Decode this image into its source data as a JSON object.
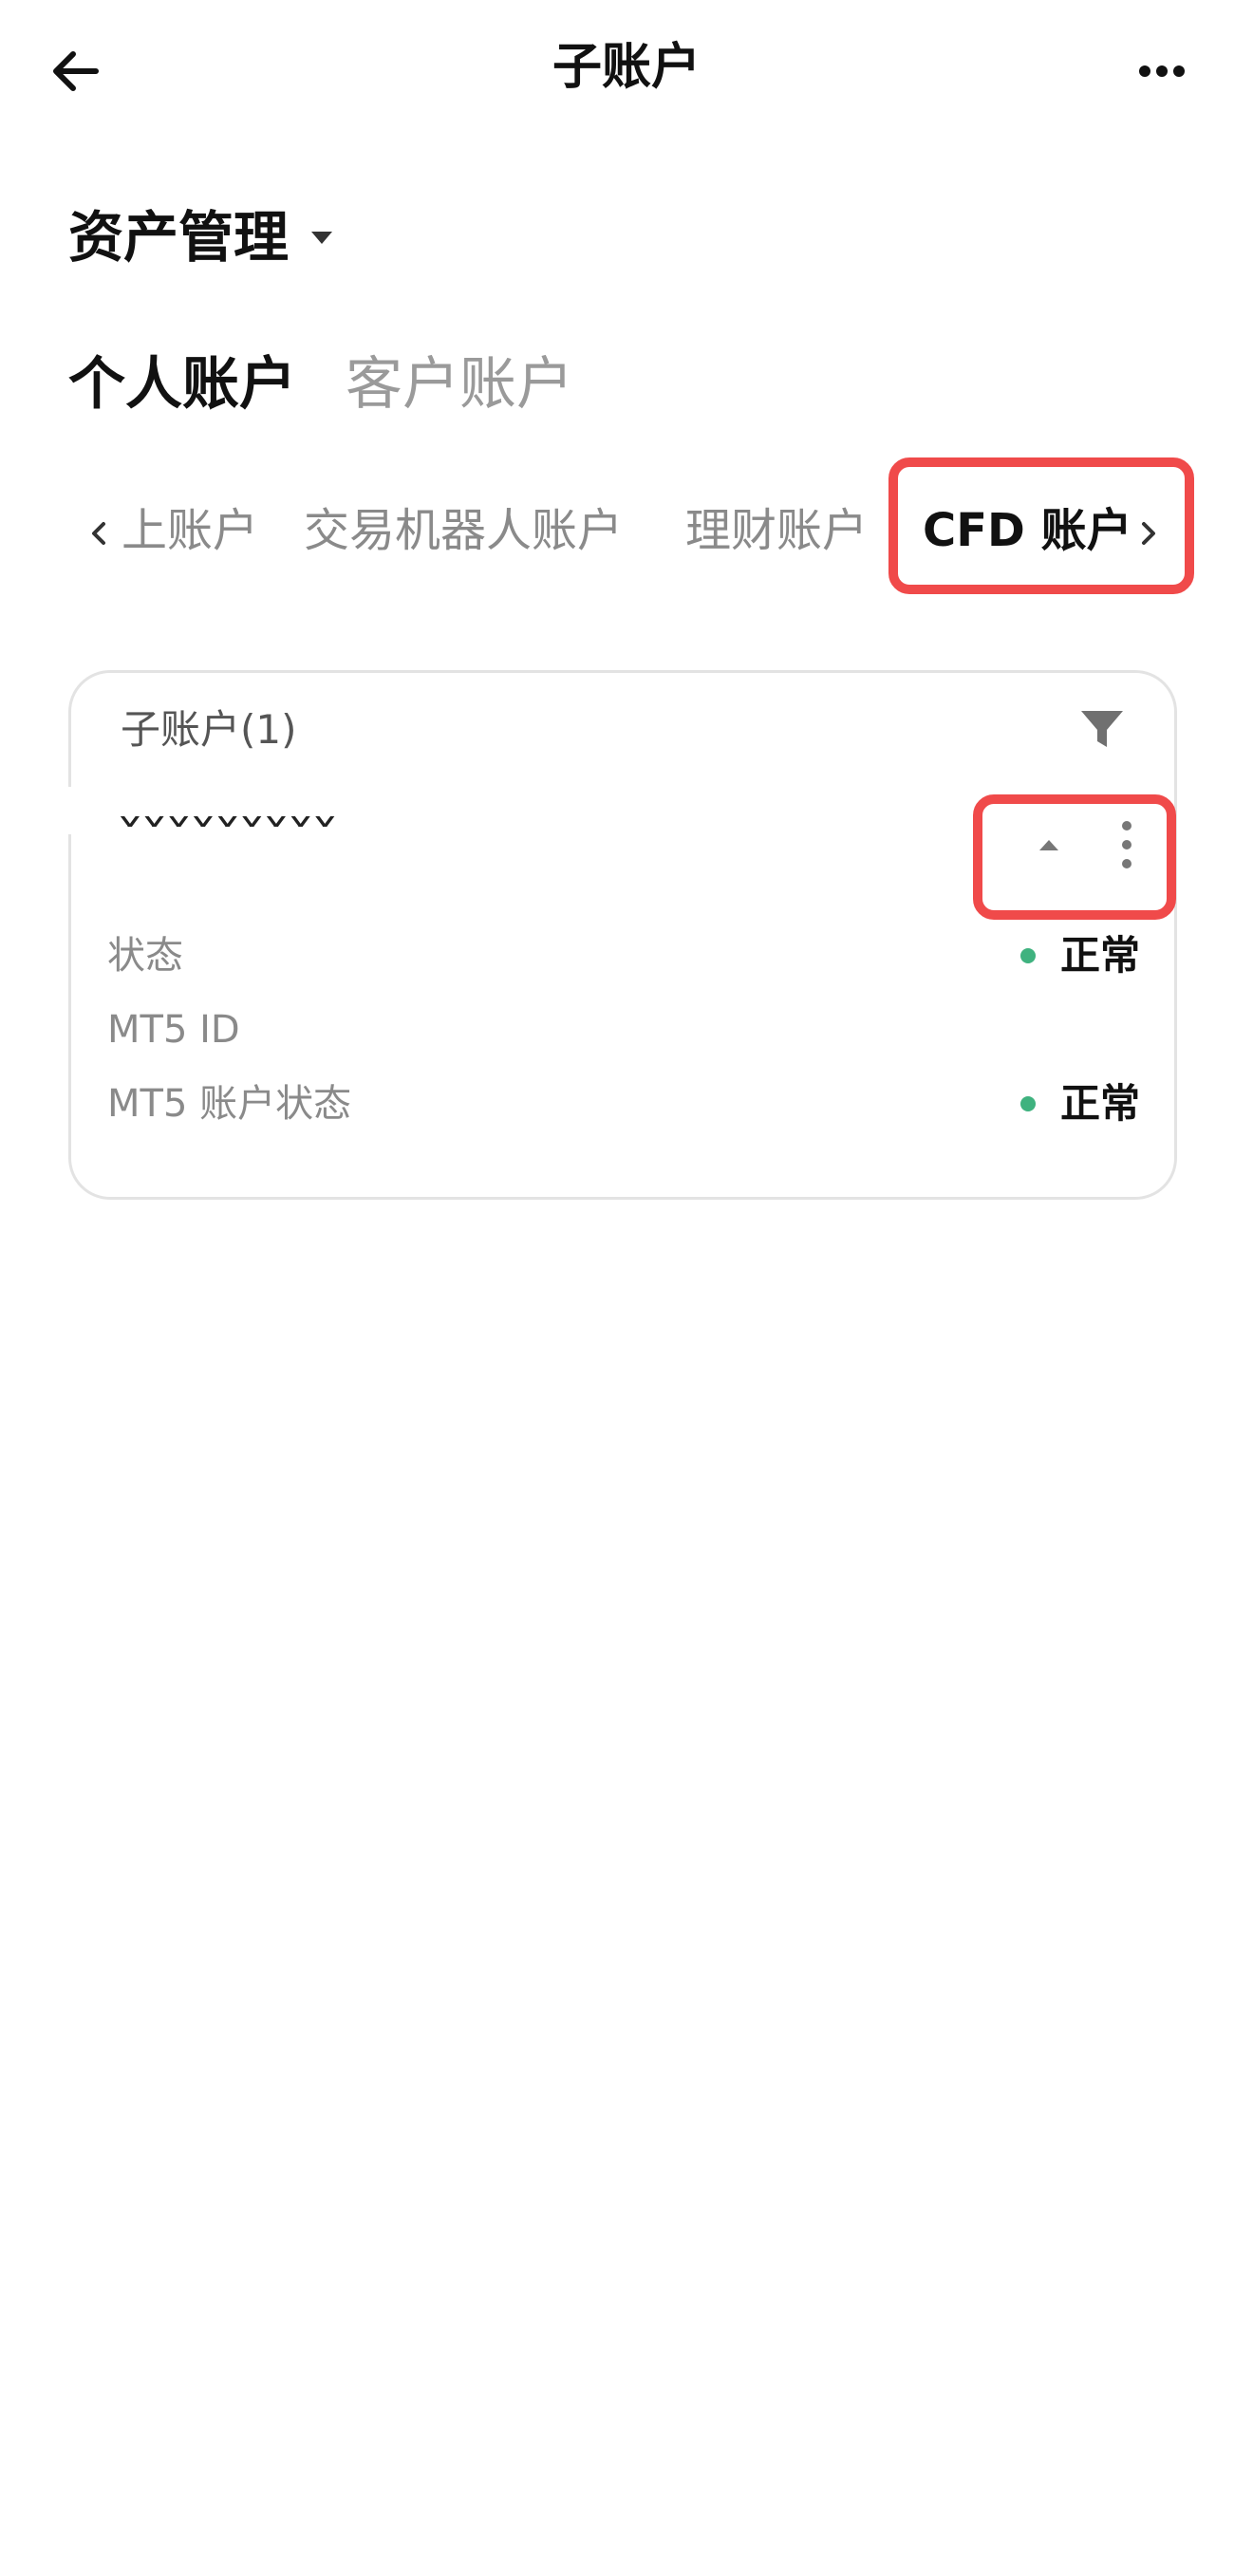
{
  "header": {
    "title": "子账户",
    "back_icon": "arrow-left-icon",
    "more_icon": "more-horizontal-icon"
  },
  "asset_management": {
    "label": "资产管理",
    "icon": "caret-down-icon"
  },
  "account_tabs": [
    {
      "label": "个人账户",
      "active": true
    },
    {
      "label": "客户账户",
      "active": false
    }
  ],
  "sub_tabs": {
    "items": [
      {
        "label": "上账户",
        "active": false
      },
      {
        "label": "交易机器人账户",
        "active": false
      },
      {
        "label": "理财账户",
        "active": false
      },
      {
        "label": "CFD 账户",
        "active": true
      }
    ],
    "prev_icon": "chevron-left-icon",
    "next_icon": "chevron-right-icon"
  },
  "card": {
    "header": "子账户(1)",
    "filter_icon": "filter-icon",
    "account_name": "xxxxxxxxx",
    "collapse_icon": "caret-up-icon",
    "menu_icon": "more-vertical-icon",
    "rows": [
      {
        "label": "状态",
        "value": "正常"
      },
      {
        "label": "MT5 ID",
        "value": ""
      },
      {
        "label": "MT5 账户状态",
        "value": "正常"
      }
    ]
  },
  "colors": {
    "highlight": "#f04a4a",
    "status_ok": "#3fb27f",
    "text_muted": "#8a8a8a"
  }
}
